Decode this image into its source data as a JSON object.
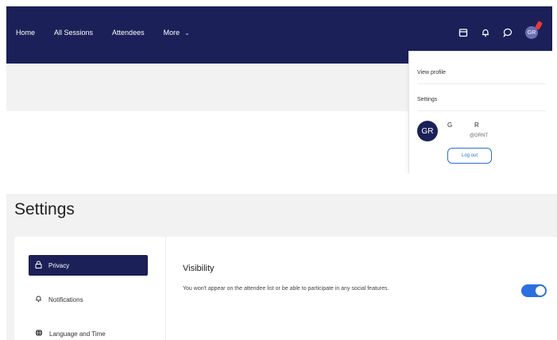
{
  "navbar": {
    "items": [
      {
        "label": "Home"
      },
      {
        "label": "All Sessions"
      },
      {
        "label": "Attendees"
      },
      {
        "label": "More"
      }
    ],
    "avatar_initials": "GR",
    "colors": {
      "background": "#1b2058",
      "badge": "#e23b3b"
    }
  },
  "dropdown": {
    "view_profile": "View profile",
    "settings": "Settings",
    "avatar_initials": "GR",
    "name_first": "G",
    "name_last": "R",
    "handle": "@GRNT",
    "logout": "Log out"
  },
  "settings": {
    "title": "Settings",
    "sidebar": [
      {
        "label": "Privacy",
        "icon": "lock-icon",
        "active": true
      },
      {
        "label": "Notifications",
        "icon": "bell-icon",
        "active": false
      },
      {
        "label": "Language and Time",
        "icon": "globe-icon",
        "active": false
      }
    ],
    "visibility": {
      "title": "Visibility",
      "description": "You won't appear on the attendee list or be able to participate in any social features.",
      "toggle_on": true
    },
    "colors": {
      "accent": "#2c6fe0",
      "active": "#1b2058"
    }
  }
}
